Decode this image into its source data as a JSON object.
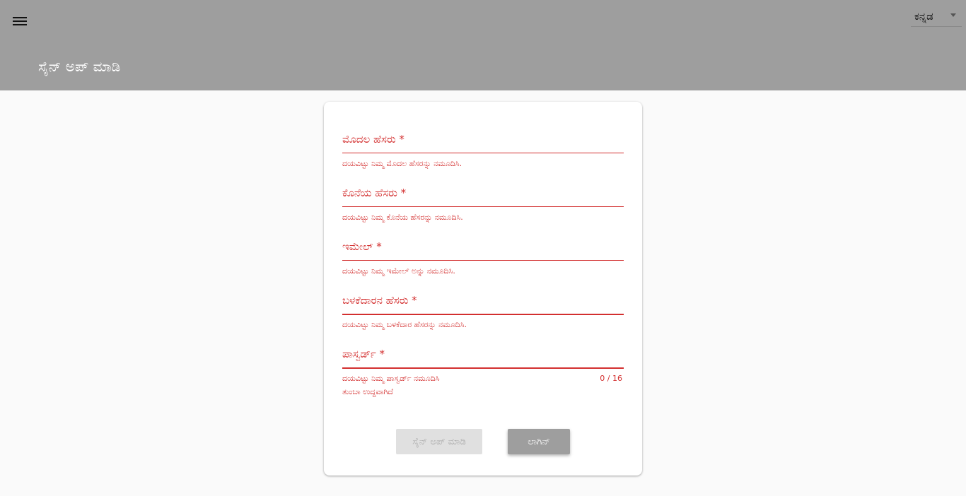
{
  "header": {
    "title": "ಸೈನ್ ಅಪ್ ಮಾಡಿ",
    "menu_icon": "hamburger-menu-icon",
    "language": {
      "selected": "ಕನ್ನಡ"
    }
  },
  "form": {
    "fields": [
      {
        "label": "ಮೊದಲ ಹೆಸರು *",
        "value": "",
        "error": "ದಯವಿಟ್ಟು ನಿಮ್ಮ ಮೊದಲ ಹೆಸರನ್ನು ನಮೂದಿಸಿ."
      },
      {
        "label": "ಕೊನೆಯ ಹೆಸರು *",
        "value": "",
        "error": "ದಯವಿಟ್ಟು ನಿಮ್ಮ ಕೊನೆಯ ಹೆಸರನ್ನು ನಮೂದಿಸಿ."
      },
      {
        "label": "ಇಮೇಲ್ *",
        "value": "",
        "error": "ದಯವಿಟ್ಟು ನಿಮ್ಮ ಇಮೇಲ್ ಅನ್ನು ನಮೂದಿಸಿ."
      },
      {
        "label": "ಬಳಕೆದಾರನ ಹೆಸರು *",
        "value": "",
        "error": "ದಯವಿಟ್ಟು ನಿಮ್ಮ ಬಳಕೆದಾರ ಹೆಸರನ್ನು ನಮೂದಿಸಿ."
      },
      {
        "label": "ಪಾಸ್ವರ್ಡ್ *",
        "value": "",
        "error": "ದಯವಿಟ್ಟು ನಿಮ್ಮ ಪಾಸ್ವರ್ಡ್ ನಮೂದಿಸಿ",
        "error2": "ತುಂಬಾ ಉದ್ದವಾಗಿದೆ",
        "counter": "0 / 16"
      }
    ],
    "signup_button": "ಸೈನ್ ಅಪ್ ಮಾಡಿ",
    "login_button": "ಲಾಗಿನ್"
  },
  "colors": {
    "appbar": "#9e9e9e",
    "error": "#d32f2f",
    "background": "#fafafa"
  }
}
